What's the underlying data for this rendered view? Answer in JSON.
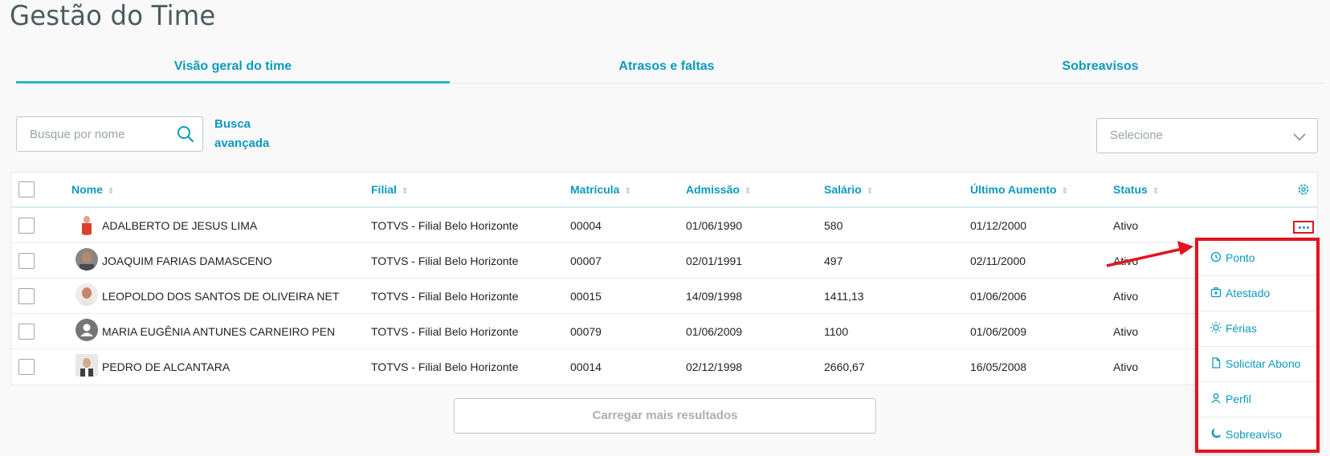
{
  "page": {
    "title": "Gestão do Time"
  },
  "tabs": [
    {
      "label": "Visão geral do time",
      "active": true
    },
    {
      "label": "Atrasos e faltas",
      "active": false
    },
    {
      "label": "Sobreavisos",
      "active": false
    }
  ],
  "search": {
    "placeholder": "Busque por nome",
    "advanced_label_line1": "Busca",
    "advanced_label_line2": "avançada"
  },
  "filter_select": {
    "placeholder": "Selecione"
  },
  "table": {
    "columns": {
      "name": "Nome",
      "branch": "Filial",
      "registration": "Matrícula",
      "admission": "Admissão",
      "salary": "Salário",
      "last_raise": "Último Aumento",
      "status": "Status"
    },
    "rows": [
      {
        "name": "ADALBERTO DE JESUS LIMA",
        "branch": "TOTVS - Filial Belo Horizonte",
        "registration": "00004",
        "admission": "01/06/1990",
        "salary": "580",
        "last_raise": "01/12/2000",
        "status": "Ativo"
      },
      {
        "name": "JOAQUIM FARIAS DAMASCENO",
        "branch": "TOTVS - Filial Belo Horizonte",
        "registration": "00007",
        "admission": "02/01/1991",
        "salary": "497",
        "last_raise": "02/11/2000",
        "status": "Ativo"
      },
      {
        "name": "LEOPOLDO DOS SANTOS DE OLIVEIRA NET",
        "branch": "TOTVS - Filial Belo Horizonte",
        "registration": "00015",
        "admission": "14/09/1998",
        "salary": "1411,13",
        "last_raise": "01/06/2006",
        "status": "Ativo"
      },
      {
        "name": "MARIA EUGÊNIA ANTUNES CARNEIRO PEN",
        "branch": "TOTVS - Filial Belo Horizonte",
        "registration": "00079",
        "admission": "01/06/2009",
        "salary": "1100",
        "last_raise": "01/06/2009",
        "status": "Ativo"
      },
      {
        "name": "PEDRO DE ALCANTARA",
        "branch": "TOTVS - Filial Belo Horizonte",
        "registration": "00014",
        "admission": "02/12/1998",
        "salary": "2660,67",
        "last_raise": "16/05/2008",
        "status": "Ativo"
      }
    ]
  },
  "load_more": {
    "label": "Carregar mais resultados"
  },
  "row_menu": {
    "items": [
      {
        "label": "Ponto",
        "icon": "clock-icon"
      },
      {
        "label": "Atestado",
        "icon": "medical-kit-icon"
      },
      {
        "label": "Férias",
        "icon": "sun-icon"
      },
      {
        "label": "Solicitar Abono",
        "icon": "document-icon"
      },
      {
        "label": "Perfil",
        "icon": "user-icon"
      },
      {
        "label": "Sobreaviso",
        "icon": "moon-icon"
      }
    ]
  },
  "colors": {
    "accent": "#0c9abe",
    "highlight": "#e3131d",
    "tab_underline": "#29b6c5"
  }
}
